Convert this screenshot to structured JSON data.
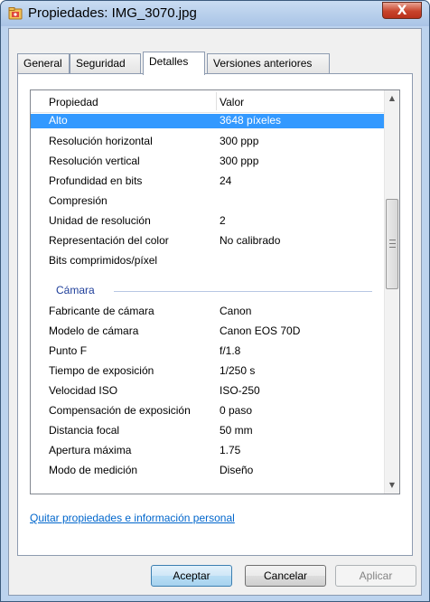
{
  "window": {
    "title": "Propiedades: IMG_3070.jpg",
    "close_glyph": "X"
  },
  "tabs": [
    {
      "label": "General",
      "active": false
    },
    {
      "label": "Seguridad",
      "active": false
    },
    {
      "label": "Detalles",
      "active": true
    },
    {
      "label": "Versiones anteriores",
      "active": false
    }
  ],
  "table": {
    "headers": {
      "property": "Propiedad",
      "value": "Valor"
    },
    "rows_top": [
      {
        "name": "Alto",
        "value": "3648 píxeles",
        "selected": true
      },
      {
        "name": "Resolución horizontal",
        "value": "300 ppp"
      },
      {
        "name": "Resolución vertical",
        "value": "300 ppp"
      },
      {
        "name": "Profundidad en bits",
        "value": "24"
      },
      {
        "name": "Compresión",
        "value": ""
      },
      {
        "name": "Unidad de resolución",
        "value": "2"
      },
      {
        "name": "Representación del color",
        "value": "No calibrado"
      },
      {
        "name": "Bits comprimidos/píxel",
        "value": ""
      }
    ],
    "group": {
      "label": "Cámara"
    },
    "rows_camera": [
      {
        "name": "Fabricante de cámara",
        "value": "Canon"
      },
      {
        "name": "Modelo de cámara",
        "value": "Canon EOS 70D"
      },
      {
        "name": "Punto F",
        "value": "f/1.8"
      },
      {
        "name": "Tiempo de exposición",
        "value": "1/250 s"
      },
      {
        "name": "Velocidad ISO",
        "value": "ISO-250"
      },
      {
        "name": "Compensación de exposición",
        "value": "0 paso"
      },
      {
        "name": "Distancia focal",
        "value": "50 mm"
      },
      {
        "name": "Apertura máxima",
        "value": "1.75"
      },
      {
        "name": "Modo de medición",
        "value": "Diseño"
      }
    ]
  },
  "link": {
    "label": "Quitar propiedades e información personal"
  },
  "buttons": {
    "accept": "Aceptar",
    "cancel": "Cancelar",
    "apply": "Aplicar"
  },
  "colors": {
    "selection": "#3399ff",
    "group_label": "#1e3e9a",
    "link": "#0066cc"
  },
  "icons": {
    "app": "properties-window-icon",
    "close": "close-icon",
    "scroll_up": "scroll-up-arrow-icon",
    "scroll_down": "scroll-down-arrow-icon"
  }
}
